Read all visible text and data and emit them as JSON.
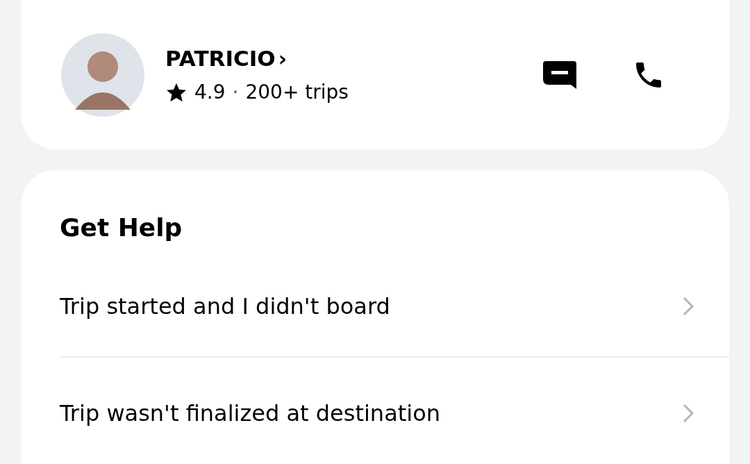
{
  "driver": {
    "name": "PATRICIO",
    "name_chevron": "›",
    "rating": "4.9",
    "separator": "·",
    "trips": "200+ trips"
  },
  "help": {
    "title": "Get Help",
    "items": [
      {
        "label": "Trip started and I didn't board"
      },
      {
        "label": "Trip wasn't finalized at destination"
      }
    ]
  }
}
